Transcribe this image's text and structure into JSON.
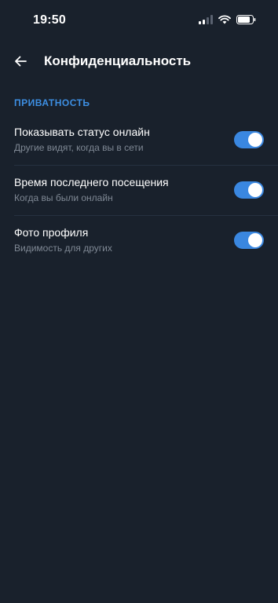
{
  "status_bar": {
    "time": "19:50"
  },
  "header": {
    "title": "Конфиденциальность",
    "back_icon": "arrow-left-icon"
  },
  "section": {
    "title": "ПРИВАТНОСТЬ"
  },
  "settings": [
    {
      "title": "Показывать статус онлайн",
      "subtitle": "Другие видят, когда вы в сети",
      "enabled": true
    },
    {
      "title": "Время последнего посещения",
      "subtitle": "Когда вы были онлайн",
      "enabled": true
    },
    {
      "title": "Фото профиля",
      "subtitle": "Видимость для других",
      "enabled": true
    }
  ],
  "colors": {
    "background": "#19212c",
    "accent": "#3a87e0",
    "section_header": "#3d8fe3",
    "subtitle": "#7f8894",
    "divider": "#263140"
  }
}
